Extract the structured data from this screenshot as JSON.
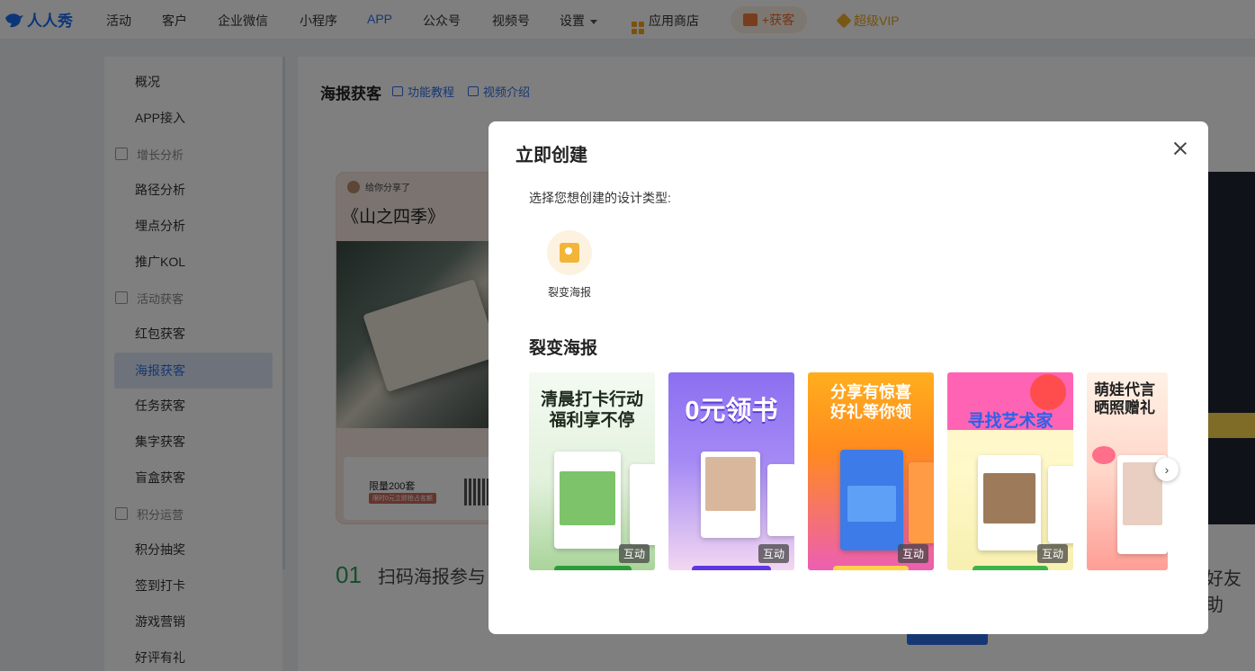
{
  "topnav": {
    "logo_text": "人人秀",
    "items": [
      "活动",
      "客户",
      "企业微信",
      "小程序",
      "APP",
      "公众号",
      "视频号",
      "设置"
    ],
    "active": "APP",
    "app_store": "应用商店",
    "get_customers": "+获客",
    "vip": "超级VIP"
  },
  "sidebar": {
    "items": [
      "概况",
      "APP接入",
      "增长分析",
      "路径分析",
      "埋点分析",
      "推广KOL",
      "活动获客",
      "红包获客",
      "海报获客",
      "任务获客",
      "集字获客",
      "盲盒获客",
      "积分运营",
      "积分抽奖",
      "签到打卡",
      "游戏营销",
      "好评有礼"
    ],
    "active": "海报获客"
  },
  "main": {
    "title": "海报获客",
    "link_tutorial": "功能教程",
    "link_video": "视频介绍",
    "preview": {
      "share_text": "给你分享了",
      "book_title": "《山之四季》",
      "limit": "限量200套",
      "tag": "限时0元立即抢占名额"
    },
    "step_num": "01",
    "step_text": "扫码海报参与",
    "right_text": "好友助"
  },
  "modal": {
    "title": "立即创建",
    "prompt": "选择您想创建的设计类型:",
    "type_label": "裂变海报",
    "section_title": "裂变海报",
    "templates": [
      {
        "title": "清晨打卡行动\n福利享不停",
        "badge": "互动"
      },
      {
        "title": "0元领书",
        "badge": "互动"
      },
      {
        "title": "分享有惊喜\n好礼等你领",
        "badge": "互动"
      },
      {
        "title": "寻找艺术家",
        "badge": "互动"
      },
      {
        "title": "萌娃代言\n晒照赠礼",
        "badge": ""
      }
    ],
    "colors": {
      "accent": "#2f6ee6",
      "overlay": "rgba(0,0,0,0.5)"
    }
  }
}
